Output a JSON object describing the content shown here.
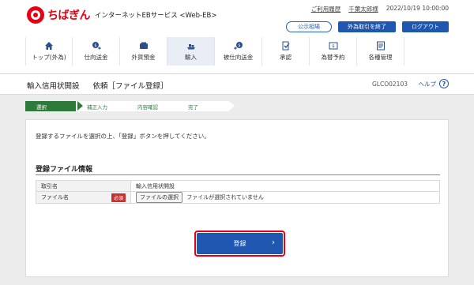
{
  "header": {
    "brand": "ちばぎん",
    "subtitle": "インターネットEBサービス <Web-EB>",
    "usage_history": "ご利用履歴",
    "user_name": "千葉太郎様",
    "datetime": "2022/10/19 10:00:00",
    "buttons": [
      "公示相場",
      "外為取引を終了",
      "ログアウト"
    ]
  },
  "nav": {
    "items": [
      {
        "label": "トップ(外為)",
        "icon": "home-icon"
      },
      {
        "label": "仕向送金",
        "icon": "remittance-icon"
      },
      {
        "label": "外貨預金",
        "icon": "deposit-icon"
      },
      {
        "label": "輸入",
        "icon": "import-icon",
        "active": true
      },
      {
        "label": "被仕向送金",
        "icon": "incoming-remittance-icon"
      },
      {
        "label": "承認",
        "icon": "approval-icon"
      },
      {
        "label": "為替予約",
        "icon": "exchange-icon"
      },
      {
        "label": "各種管理",
        "icon": "management-icon"
      }
    ]
  },
  "page": {
    "title_main": "輸入信用状開設",
    "title_sub": "依頼［ファイル登録］",
    "screen_id": "GLCO02103",
    "help": "ヘルプ"
  },
  "steps": [
    "選択",
    "補正入力",
    "内容確認",
    "完了"
  ],
  "content": {
    "intro": "登録するファイルを選択の上、「登録」ボタンを押してください。",
    "section_title": "登録ファイル情報",
    "rows": [
      {
        "label": "取引名",
        "value": "輸入信用状開設"
      },
      {
        "label": "ファイル名",
        "required": "必須",
        "button": "ファイルの選択",
        "status": "ファイルが選択されていません"
      }
    ],
    "submit": "登録"
  },
  "colors": {
    "brand_red": "#e60012",
    "primary_blue": "#1e56b0",
    "step_green": "#2d7a3a"
  }
}
